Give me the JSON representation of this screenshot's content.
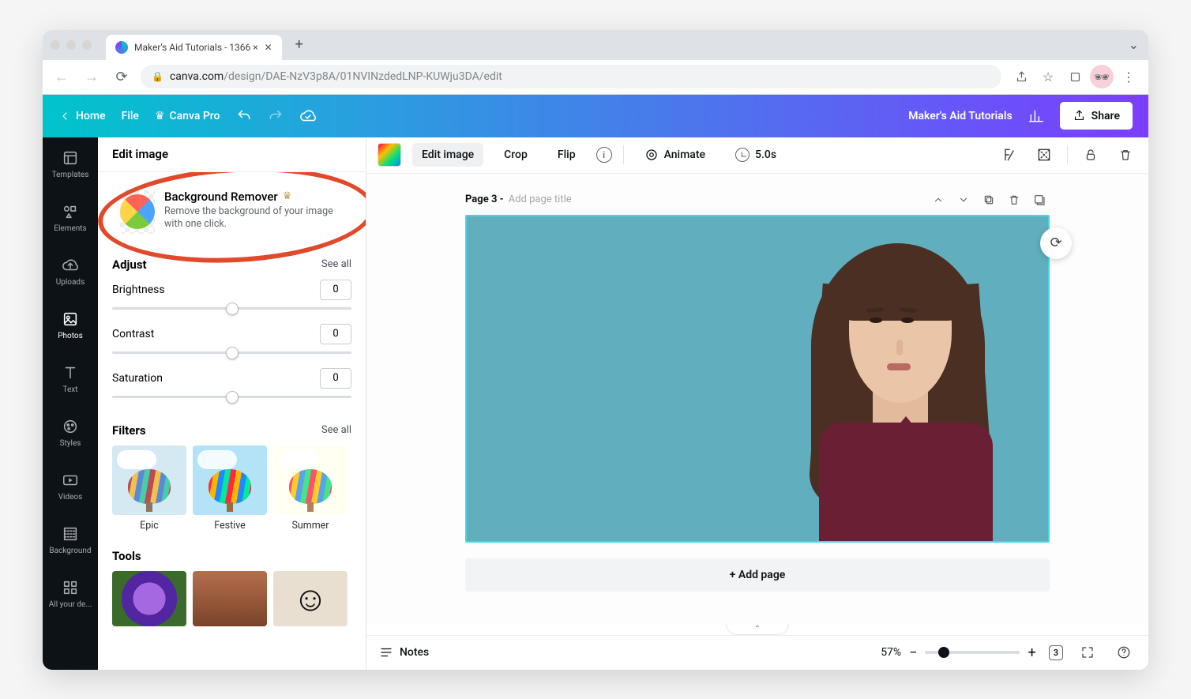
{
  "browser": {
    "tab_title": "Maker's Aid Tutorials - 1366 ×",
    "url_domain": "canva.com",
    "url_path": "/design/DAE-NzV3p8A/01NVINzdedLNP-KUWju3DA/edit"
  },
  "header": {
    "home": "Home",
    "file": "File",
    "plan": "Canva Pro",
    "project_title": "Maker's Aid Tutorials",
    "share": "Share"
  },
  "rail": {
    "items": [
      {
        "id": "templates",
        "label": "Templates"
      },
      {
        "id": "elements",
        "label": "Elements"
      },
      {
        "id": "uploads",
        "label": "Uploads"
      },
      {
        "id": "photos",
        "label": "Photos"
      },
      {
        "id": "text",
        "label": "Text"
      },
      {
        "id": "styles",
        "label": "Styles"
      },
      {
        "id": "videos",
        "label": "Videos"
      },
      {
        "id": "background",
        "label": "Background"
      },
      {
        "id": "more",
        "label": "All your de..."
      }
    ],
    "active": "photos"
  },
  "panel": {
    "title": "Edit image",
    "bg_remover": {
      "title": "Background Remover",
      "desc": "Remove the background of your image with one click."
    },
    "adjust": {
      "title": "Adjust",
      "see_all": "See all",
      "items": [
        {
          "label": "Brightness",
          "value": "0"
        },
        {
          "label": "Contrast",
          "value": "0"
        },
        {
          "label": "Saturation",
          "value": "0"
        }
      ]
    },
    "filters": {
      "title": "Filters",
      "see_all": "See all",
      "items": [
        {
          "label": "Epic"
        },
        {
          "label": "Festive"
        },
        {
          "label": "Summer"
        }
      ]
    },
    "tools": {
      "title": "Tools"
    }
  },
  "context": {
    "edit_image": "Edit image",
    "crop": "Crop",
    "flip": "Flip",
    "animate": "Animate",
    "duration": "5.0s"
  },
  "page": {
    "label": "Page 3 -",
    "placeholder": "Add page title",
    "add_page": "+ Add page"
  },
  "footer": {
    "notes": "Notes",
    "zoom": "57%",
    "page_count": "3"
  }
}
